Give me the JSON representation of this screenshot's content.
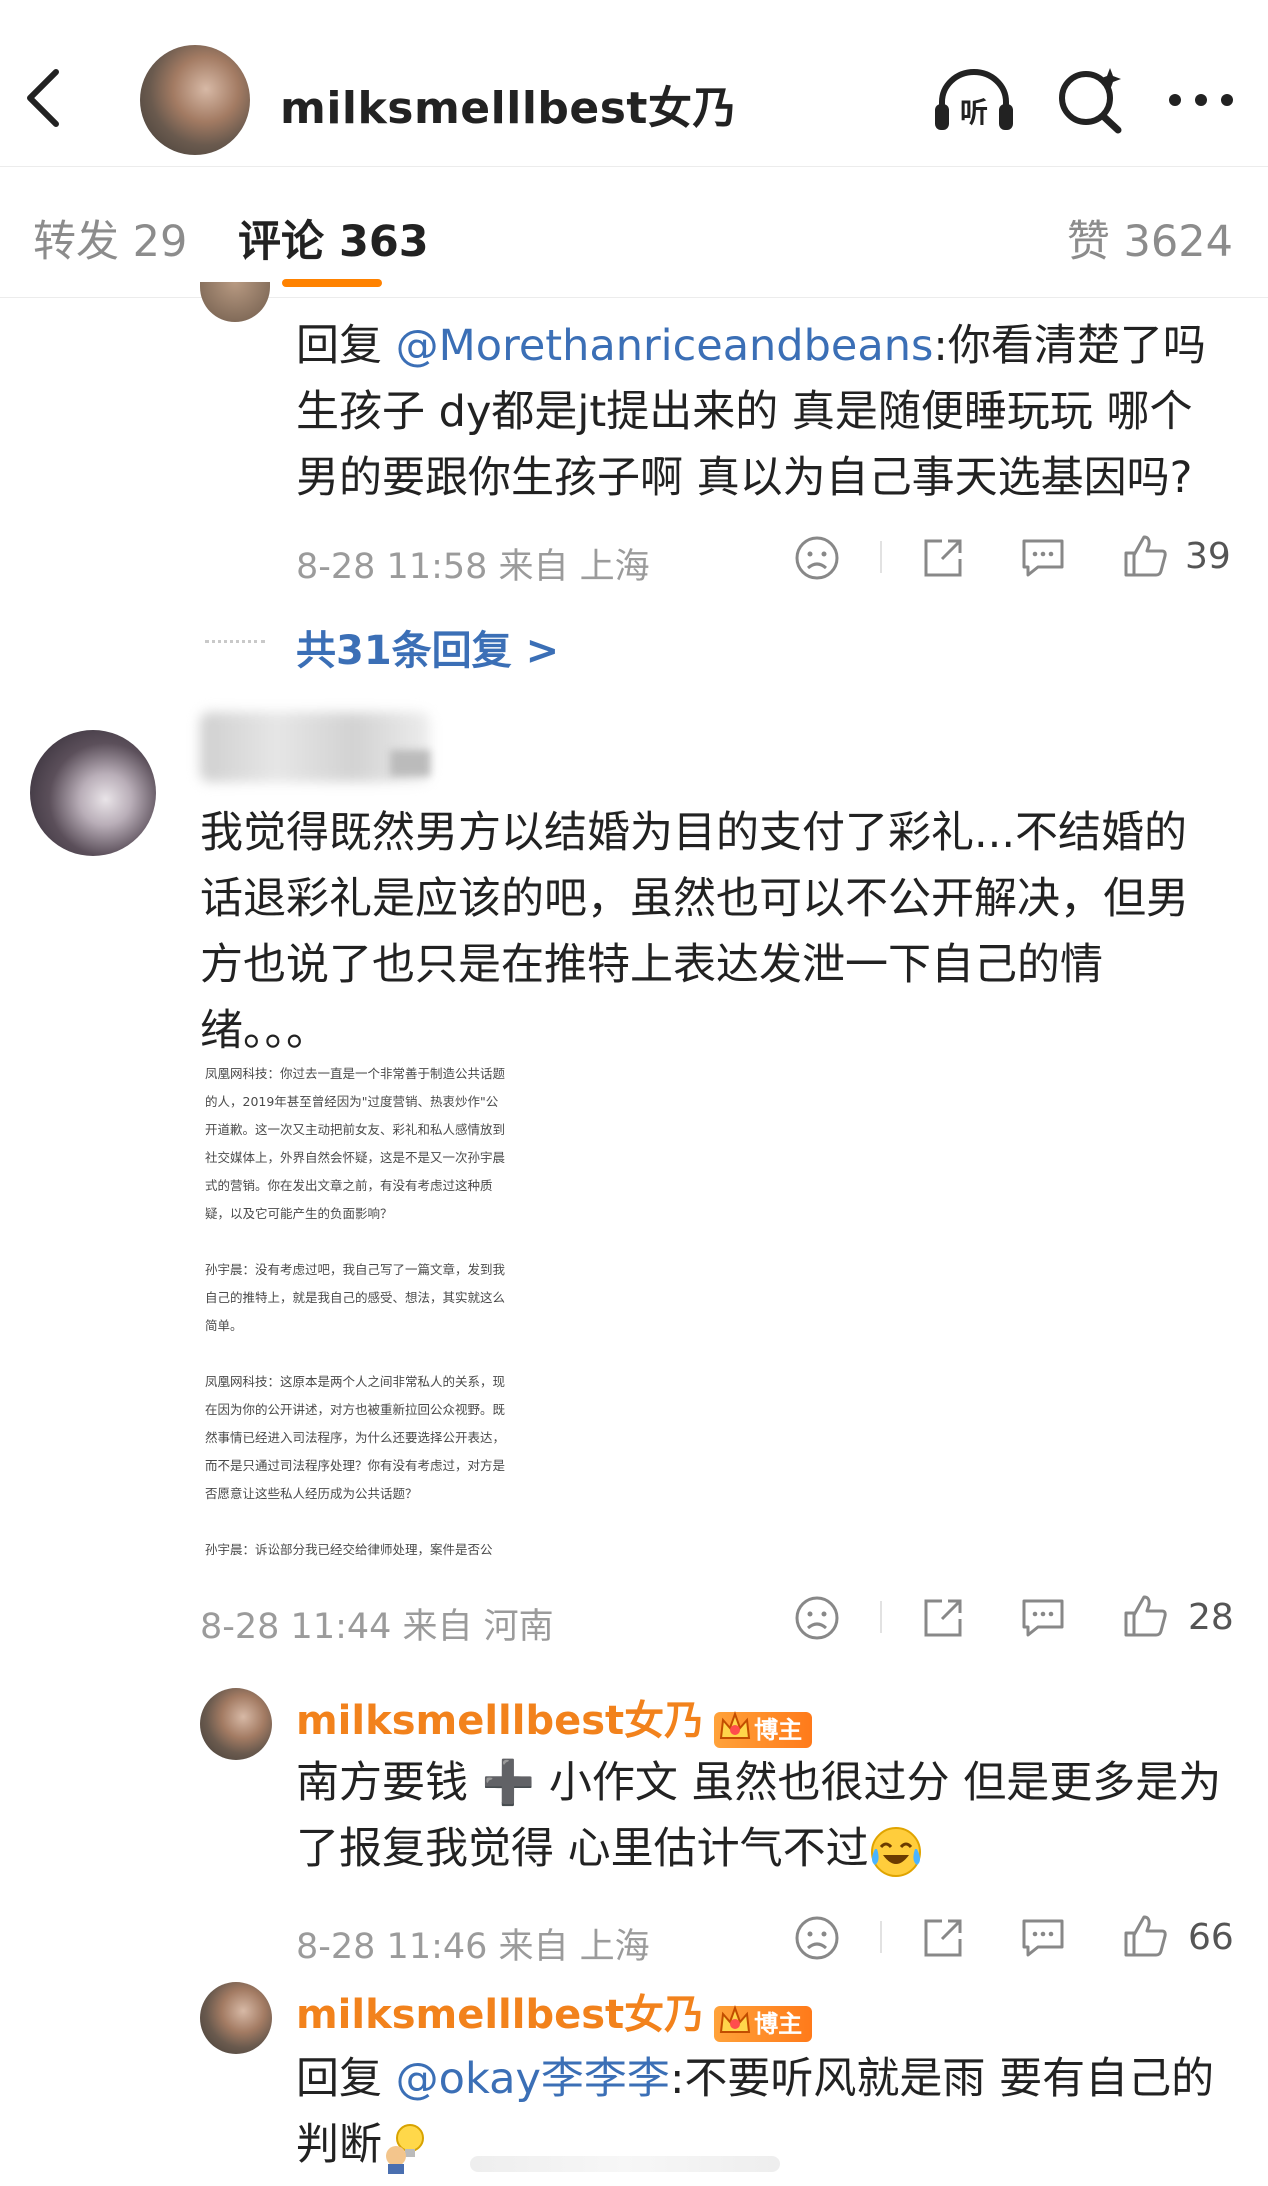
{
  "header": {
    "title": "milksmelllbest女乃",
    "listen_label": "听"
  },
  "tabs": {
    "repost": "转发 29",
    "comment": "评论 363",
    "like": "赞 3624"
  },
  "reply_top": {
    "prefix": "回复 ",
    "mention": "@Morethanriceandbeans",
    "text_line1": ":你看清楚了吗",
    "text_line2": "生孩子 dy都是jt提出来的 真是随便睡玩玩 哪个",
    "text_line3": "男的要跟你生孩子啊 真以为自己事天选基因吗?",
    "meta": "8-28 11:58 来自 上海",
    "likes": "39",
    "more_replies": "共31条回复 >"
  },
  "comment_main": {
    "text_line1": "我觉得既然男方以结婚为目的支付了彩礼...不结婚的",
    "text_line2": "话退彩礼是应该的吧，虽然也可以不公开解决，但男",
    "text_line3": "方也说了也只是在推特上表达发泄一下自己的情",
    "text_line4": "绪。。。",
    "meta": "8-28 11:44 来自 河南",
    "likes": "28",
    "image_lines": [
      "凤凰网科技：你过去一直是一个非常善于制造公共话题",
      "的人，2019年甚至曾经因为\"过度营销、热衷炒作\"公",
      "开道歉。这一次又主动把前女友、彩礼和私人感情放到",
      "社交媒体上，外界自然会怀疑，这是不是又一次孙宇晨",
      "式的营销。你在发出文章之前，有没有考虑过这种质",
      "疑，以及它可能产生的负面影响？",
      "",
      "孙宇晨：没有考虑过吧，我自己写了一篇文章，发到我",
      "自己的推特上，就是我自己的感受、想法，其实就这么",
      "简单。",
      "",
      "凤凰网科技：这原本是两个人之间非常私人的关系，现",
      "在因为你的公开讲述，对方也被重新拉回公众视野。既",
      "然事情已经进入司法程序，为什么还要选择公开表达，",
      "而不是只通过司法程序处理？你有没有考虑过，对方是",
      "否愿意让这些私人经历成为公共话题？",
      "",
      "孙宇晨：诉讼部分我已经交给律师处理，案件是否公"
    ]
  },
  "sub_reply_1": {
    "name": "milksmelllbest女乃",
    "badge": "博主",
    "text_line1": "南方要钱 ➕ 小作文 虽然也很过分 但是更多是为",
    "text_line2": "了报复我觉得 心里估计气不过",
    "meta": "8-28 11:46 来自 上海",
    "likes": "66"
  },
  "sub_reply_2": {
    "name": "milksmelllbest女乃",
    "badge": "博主",
    "prefix": "回复 ",
    "mention": "@okay李李李",
    "text_line1": ":不要听风就是雨 要有自己的",
    "text_line2": "判断"
  },
  "colors": {
    "accent": "#ff8200",
    "link": "#3b6fb6",
    "blogger": "#f2821c",
    "meta": "#9b9b9b"
  },
  "icons": [
    "back-icon",
    "listen-icon",
    "search-icon",
    "more-icon",
    "sad-face-icon",
    "share-icon",
    "comment-icon",
    "thumbs-up-icon",
    "crown-icon",
    "laughing-crying-emoji",
    "lightbulb-emoji"
  ]
}
